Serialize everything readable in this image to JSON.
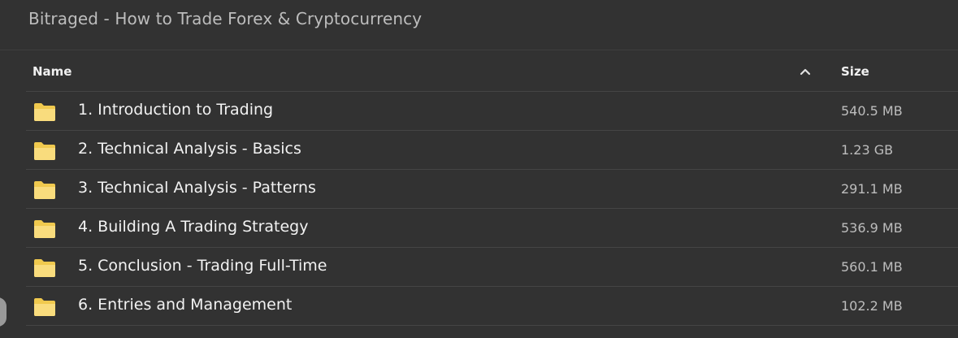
{
  "window": {
    "title": "Bitraged - How to Trade Forex & Cryptocurrency"
  },
  "columns": {
    "name": "Name",
    "size": "Size",
    "sort_icon": "chevron-up-icon"
  },
  "folder_icon_color": "#f7d774",
  "rows": [
    {
      "name": "1. Introduction to Trading",
      "size": "540.5 MB"
    },
    {
      "name": "2. Technical Analysis - Basics",
      "size": "1.23 GB"
    },
    {
      "name": "3. Technical Analysis - Patterns",
      "size": "291.1 MB"
    },
    {
      "name": "4. Building A Trading Strategy",
      "size": "536.9 MB"
    },
    {
      "name": "5. Conclusion - Trading Full-Time",
      "size": "560.1 MB"
    },
    {
      "name": "6. Entries and Management",
      "size": "102.2 MB"
    }
  ]
}
